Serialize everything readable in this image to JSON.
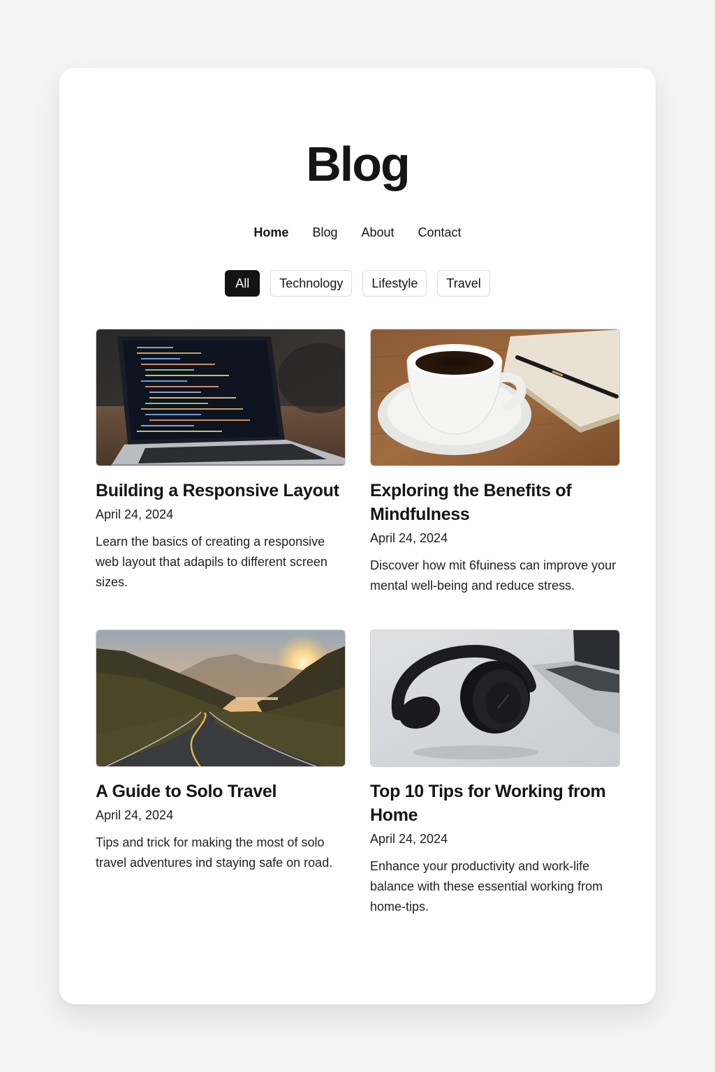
{
  "header": {
    "title": "Blog"
  },
  "nav": {
    "items": [
      {
        "label": "Home",
        "active": true
      },
      {
        "label": "Blog",
        "active": false
      },
      {
        "label": "About",
        "active": false
      },
      {
        "label": "Contact",
        "active": false
      }
    ]
  },
  "filters": {
    "items": [
      {
        "label": "All",
        "active": true
      },
      {
        "label": "Technology",
        "active": false
      },
      {
        "label": "Lifestyle",
        "active": false
      },
      {
        "label": "Travel",
        "active": false
      }
    ]
  },
  "posts": [
    {
      "title": "Building a Responsive Layout",
      "date": "April 24, 2024",
      "excerpt": "Learn the basics of creating a responsive web layout that adapils to different screen sizes.",
      "image": "laptop-with-code"
    },
    {
      "title": "Exploring the Benefits of Mindfulness",
      "date": "April 24, 2024",
      "excerpt": "Discover how mit 6fuiness can improve your mental well-being and reduce stress.",
      "image": "coffee-cup-and-notebook"
    },
    {
      "title": "A Guide to Solo Travel",
      "date": "April 24, 2024",
      "excerpt": "Tips and trick for making the most of solo travel adventures ind staying safe on road.",
      "image": "mountain-road-sunset"
    },
    {
      "title": "Top 10 Tips for Working from Home",
      "date": "April 24, 2024",
      "excerpt": "Enhance your productivity and work-life balance with these essential working from home-tips.",
      "image": "headphones-and-laptop"
    }
  ],
  "colors": {
    "background": "#f4f4f4",
    "card": "#ffffff",
    "text": "#151515",
    "active_chip": "#141414"
  }
}
